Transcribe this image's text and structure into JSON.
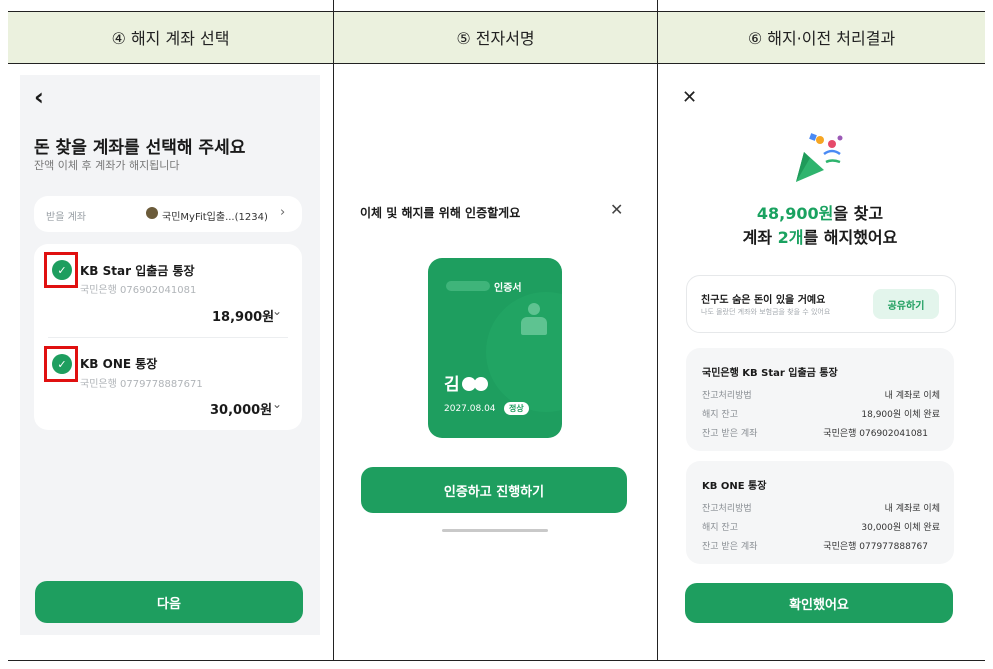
{
  "headers": {
    "step4": "④ 해지 계좌 선택",
    "step5": "⑤ 전자서명",
    "step6": "⑥ 해지·이전 처리결과"
  },
  "screen1": {
    "back": "‹",
    "title": "돈 찾을 계좌를 선택해 주세요",
    "subtitle": "잔액 이체 후 계좌가 해지됩니다",
    "receive_label": "받을 계좌",
    "receive_account": "국민MyFit입출...(1234)",
    "accounts": [
      {
        "name": "KB Star 입출금 통장",
        "number": "국민은행 076902041081",
        "amount": "18,900원"
      },
      {
        "name": "KB ONE 통장",
        "number": "국민은행 0779778887671",
        "amount": "30,000원"
      }
    ],
    "next_button": "다음"
  },
  "screen2": {
    "sheet_title": "이체 및 해지를 위해 인증할게요",
    "cert_label": "인증서",
    "cert_name": "김",
    "cert_expiry": "2027.08.04",
    "cert_status": "정상",
    "proceed_button": "인증하고 진행하기"
  },
  "screen3": {
    "amount_line_prefix": "48,900원",
    "amount_line_suffix": "을 찾고",
    "count_line_prefix": "계좌 ",
    "count_line_highlight": "2개",
    "count_line_suffix": "를 해지했어요",
    "share_title": "친구도 숨은 돈이 있을 거예요",
    "share_sub": "나도 몰랐던 계좌와 보험금을 찾을 수 있어요",
    "share_button": "공유하기",
    "results": [
      {
        "title": "국민은행 KB Star 입출금 통장",
        "method_label": "잔고처리방법",
        "method_value": "내 계좌로 이체",
        "balance_label": "해지 잔고",
        "balance_value": "18,900원 이체 완료",
        "target_label": "잔고 받은 계좌",
        "target_value": "국민은행 076902041081"
      },
      {
        "title": "KB ONE 통장",
        "method_label": "잔고처리방법",
        "method_value": "내 계좌로 이체",
        "balance_label": "해지 잔고",
        "balance_value": "30,000원 이체 완료",
        "target_label": "잔고 받은 계좌",
        "target_value": "국민은행 077977888767"
      }
    ],
    "confirm_button": "확인했어요"
  },
  "colors": {
    "accent": "#1e9e5f",
    "header_band": "#ebf1de",
    "highlight_box": "#e01010"
  }
}
